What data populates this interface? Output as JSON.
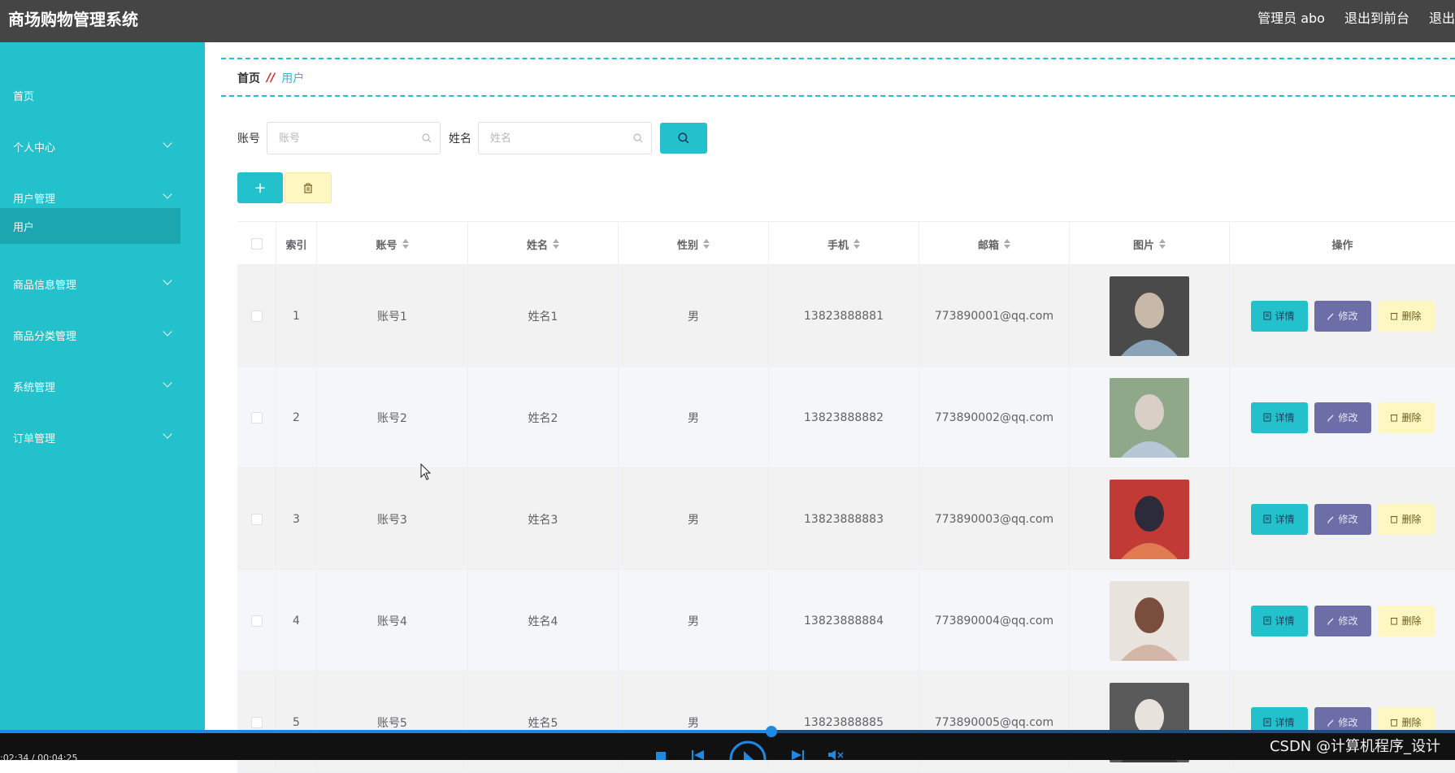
{
  "header": {
    "title": "商场购物管理系统",
    "user_label": "管理员 abo",
    "to_front_label": "退出到前台",
    "logout_label": "退出"
  },
  "sidebar": {
    "items": [
      {
        "label": "首页",
        "has_arrow": false
      },
      {
        "label": "个人中心",
        "has_arrow": true
      },
      {
        "label": "用户管理",
        "has_arrow": true
      },
      {
        "label": "用户",
        "has_arrow": false,
        "active": true
      },
      {
        "label": "商品信息管理",
        "has_arrow": true
      },
      {
        "label": "商品分类管理",
        "has_arrow": true
      },
      {
        "label": "系统管理",
        "has_arrow": true
      },
      {
        "label": "订单管理",
        "has_arrow": true
      }
    ]
  },
  "breadcrumb": {
    "home": "首页",
    "separator": "//",
    "current": "用户"
  },
  "search": {
    "account_label": "账号",
    "account_placeholder": "账号",
    "name_label": "姓名",
    "name_placeholder": "姓名"
  },
  "table": {
    "columns": [
      "索引",
      "账号",
      "姓名",
      "性别",
      "手机",
      "邮箱",
      "图片",
      "操作"
    ],
    "rows": [
      {
        "index": "1",
        "account": "账号1",
        "name": "姓名1",
        "gender": "男",
        "phone": "13823888881",
        "email": "773890001@qq.com"
      },
      {
        "index": "2",
        "account": "账号2",
        "name": "姓名2",
        "gender": "男",
        "phone": "13823888882",
        "email": "773890002@qq.com"
      },
      {
        "index": "3",
        "account": "账号3",
        "name": "姓名3",
        "gender": "男",
        "phone": "13823888883",
        "email": "773890003@qq.com"
      },
      {
        "index": "4",
        "account": "账号4",
        "name": "姓名4",
        "gender": "男",
        "phone": "13823888884",
        "email": "773890004@qq.com"
      },
      {
        "index": "5",
        "account": "账号5",
        "name": "姓名5",
        "gender": "男",
        "phone": "13823888885",
        "email": "773890005@qq.com"
      }
    ],
    "ops": {
      "detail": "详情",
      "edit": "修改",
      "delete": "删除"
    }
  },
  "player": {
    "time": ":02:34 / 00:04:25",
    "progress": 0.53,
    "watermark": "CSDN @计算机程序_设计"
  },
  "colors": {
    "accent": "#23c1cc",
    "topbar": "#454545",
    "edit": "#6d6ea8",
    "delete": "#fff7c2"
  }
}
